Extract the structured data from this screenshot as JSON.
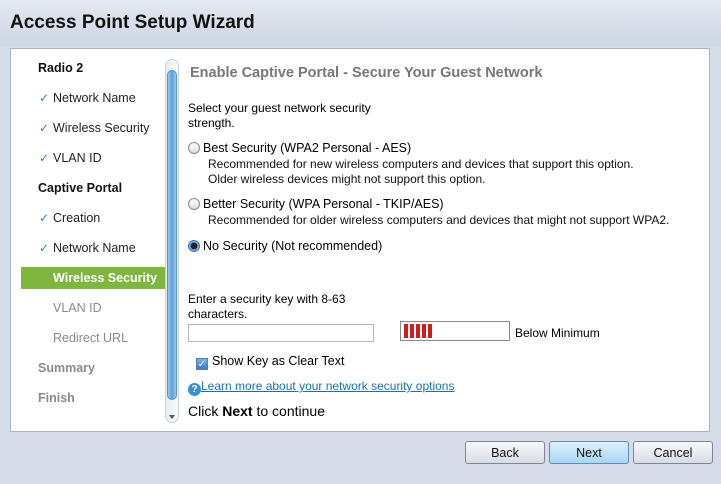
{
  "window": {
    "title": "Access Point Setup Wizard"
  },
  "sidebar": {
    "items": [
      {
        "label": "Radio 2",
        "state": "section"
      },
      {
        "label": "Network Name",
        "state": "done"
      },
      {
        "label": "Wireless Security",
        "state": "done"
      },
      {
        "label": "VLAN ID",
        "state": "done"
      },
      {
        "label": "Captive Portal",
        "state": "section"
      },
      {
        "label": "Creation",
        "state": "done"
      },
      {
        "label": "Network Name",
        "state": "done"
      },
      {
        "label": "Wireless Security",
        "state": "active"
      },
      {
        "label": "VLAN ID",
        "state": "pending"
      },
      {
        "label": "Redirect URL",
        "state": "pending"
      },
      {
        "label": "Summary",
        "state": "section-pending"
      },
      {
        "label": "Finish",
        "state": "section-pending"
      }
    ],
    "check_glyph": "✓"
  },
  "content": {
    "title": "Enable Captive Portal - Secure Your Guest Network",
    "intro": "Select your guest network security strength.",
    "options": [
      {
        "label": "Best Security (WPA2 Personal - AES)",
        "selected": false,
        "desc_lines": [
          "Recommended for new wireless computers and devices that support this option.",
          "Older wireless devices might not support this option."
        ]
      },
      {
        "label": "Better Security (WPA Personal - TKIP/AES)",
        "selected": false,
        "desc_lines": [
          "Recommended for older wireless computers and devices that might not support WPA2."
        ]
      },
      {
        "label": "No Security (Not recommended)",
        "selected": true,
        "desc_lines": []
      }
    ],
    "key_label": "Enter a security key with 8-63 characters.",
    "key_value": "",
    "strength_label": "Below Minimum",
    "strength_color": "#d21b1b",
    "show_key_label": "Show Key as Clear Text",
    "show_key_checked": true,
    "help_link": "Learn more about your network security options",
    "continue_prefix": "Click ",
    "continue_bold": "Next",
    "continue_suffix": " to continue"
  },
  "buttons": {
    "back": "Back",
    "next": "Next",
    "cancel": "Cancel"
  },
  "colors": {
    "accent_active": "#7fb63d",
    "link": "#1b6fb6",
    "check": "#2f7fbf"
  }
}
